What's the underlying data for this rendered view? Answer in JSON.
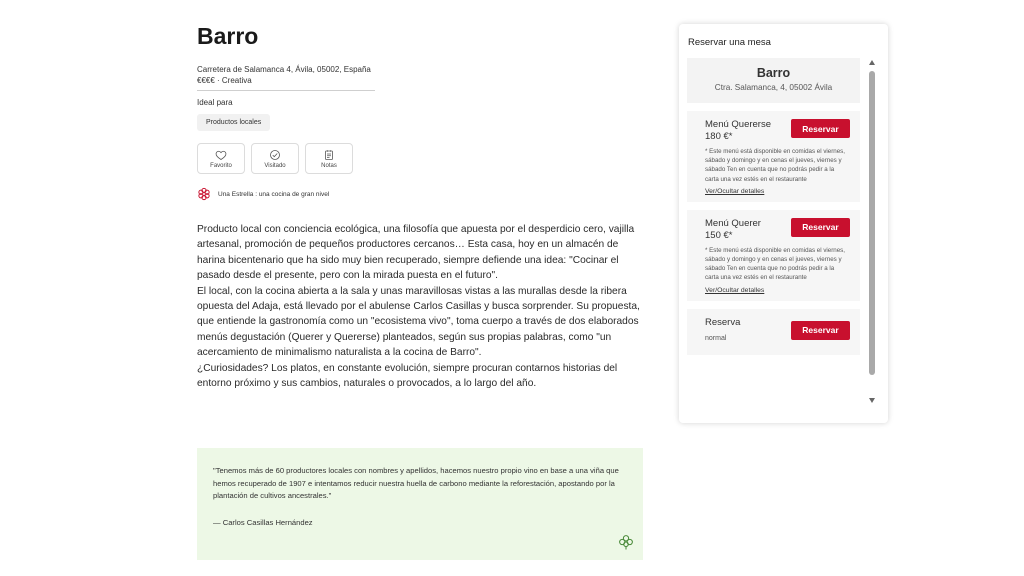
{
  "restaurant": {
    "name": "Barro",
    "address": "Carretera de Salamanca 4, Ávila, 05002, España",
    "price_style": "€€€€ · Creativa",
    "ideal_label": "Ideal para",
    "tag": "Productos locales",
    "actions": [
      {
        "label": "Favorito",
        "icon": "heart-icon"
      },
      {
        "label": "Visitado",
        "icon": "check-circle-icon"
      },
      {
        "label": "Notas",
        "icon": "note-icon"
      }
    ],
    "distinction": "Una Estrella : una cocina de gran nivel",
    "description": [
      "Producto local con conciencia ecológica, una filosofía que apuesta por el desperdicio cero, vajilla artesanal, promoción de pequeños productores cercanos… Esta casa, hoy en un almacén de harina bicentenario que ha sido muy bien recuperado, siempre defiende una idea: \"Cocinar el pasado desde el presente, pero con la mirada puesta en el futuro\".",
      "El local, con la cocina abierta a la sala y unas maravillosas vistas a las murallas desde la ribera opuesta del Adaja, está llevado por el abulense Carlos Casillas y busca sorprender. Su propuesta, que entiende la gastronomía como un \"ecosistema vivo\", toma cuerpo a través de dos elaborados menús degustación (Querer y Quererse) planteados, según sus propias palabras, como \"un acercamiento de minimalismo naturalista a la cocina de Barro\".",
      "¿Curiosidades? Los platos, en constante evolución, siempre procuran contarnos historias del entorno próximo y sus cambios, naturales o provocados, a lo largo del año."
    ],
    "quote": {
      "text": "\"Tenemos más de 60 productores locales con nombres y apellidos, hacemos nuestro propio vino en base a una viña que hemos recuperado de 1907 e intentamos reducir nuestra huella de carbono mediante la reforestación, apostando por la plantación de cultivos ancestrales.\"",
      "author": "— Carlos Casillas Hernández",
      "icon": "clover-icon"
    }
  },
  "booking": {
    "title": "Reservar una mesa",
    "header_name": "Barro",
    "header_address": "Ctra. Salamanca, 4, 05002 Ávila",
    "options": [
      {
        "name": "Menú Quererse",
        "price": "180 €*",
        "button": "Reservar",
        "note": "* Este menú está disponible en comidas el viernes, sábado y domingo y en cenas el jueves, viernes y sábado Ten en cuenta que no podrás pedir a la carta una vez estés en el restaurante",
        "link": "Ver/Ocultar detalles"
      },
      {
        "name": "Menú Querer",
        "price": "150 €*",
        "button": "Reservar",
        "note": "* Este menú está disponible en comidas el viernes, sábado y domingo y en cenas el jueves, viernes y sábado Ten en cuenta que no podrás pedir a la carta una vez estés en el restaurante",
        "link": "Ver/Ocultar detalles"
      },
      {
        "name": "Reserva",
        "sub": "normal",
        "button": "Reservar"
      }
    ]
  },
  "colors": {
    "accent": "#c8102e",
    "quote_bg": "#edf8e6",
    "panel_header_bg": "#f3f3f3"
  }
}
